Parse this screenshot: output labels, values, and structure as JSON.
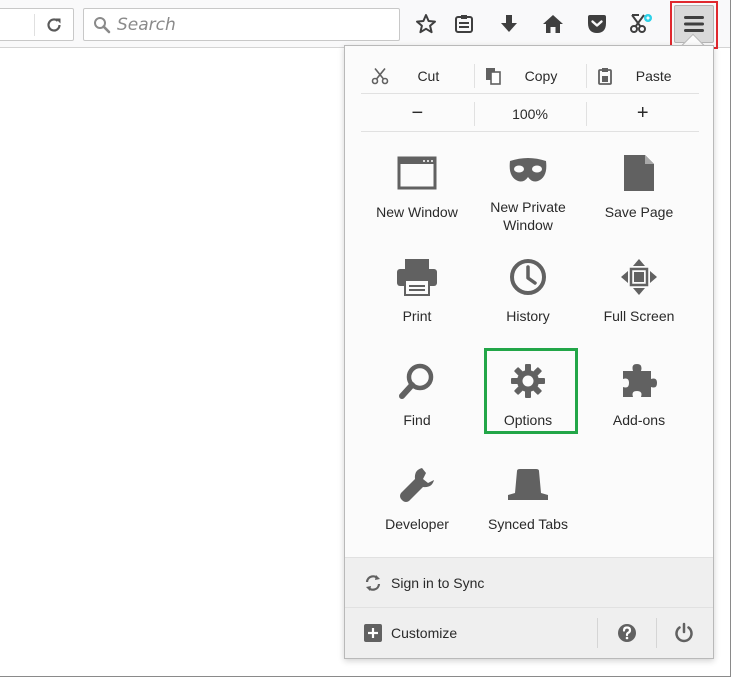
{
  "toolbar": {
    "search_placeholder": "Search"
  },
  "edit": {
    "cut": "Cut",
    "copy": "Copy",
    "paste": "Paste"
  },
  "zoom": {
    "out": "−",
    "level": "100%",
    "in": "+"
  },
  "tiles": [
    {
      "label": "New Window"
    },
    {
      "label": "New Private\nWindow"
    },
    {
      "label": "Save Page"
    },
    {
      "label": "Print"
    },
    {
      "label": "History"
    },
    {
      "label": "Full Screen"
    },
    {
      "label": "Find"
    },
    {
      "label": "Options"
    },
    {
      "label": "Add-ons"
    },
    {
      "label": "Developer"
    },
    {
      "label": "Synced Tabs"
    }
  ],
  "sync": {
    "label": "Sign in to Sync"
  },
  "footer": {
    "customize": "Customize"
  },
  "colors": {
    "icon": "#616161",
    "menu_highlight": "#e0282e",
    "options_highlight": "#22a648",
    "sync_badge": "#2ad1e8"
  }
}
